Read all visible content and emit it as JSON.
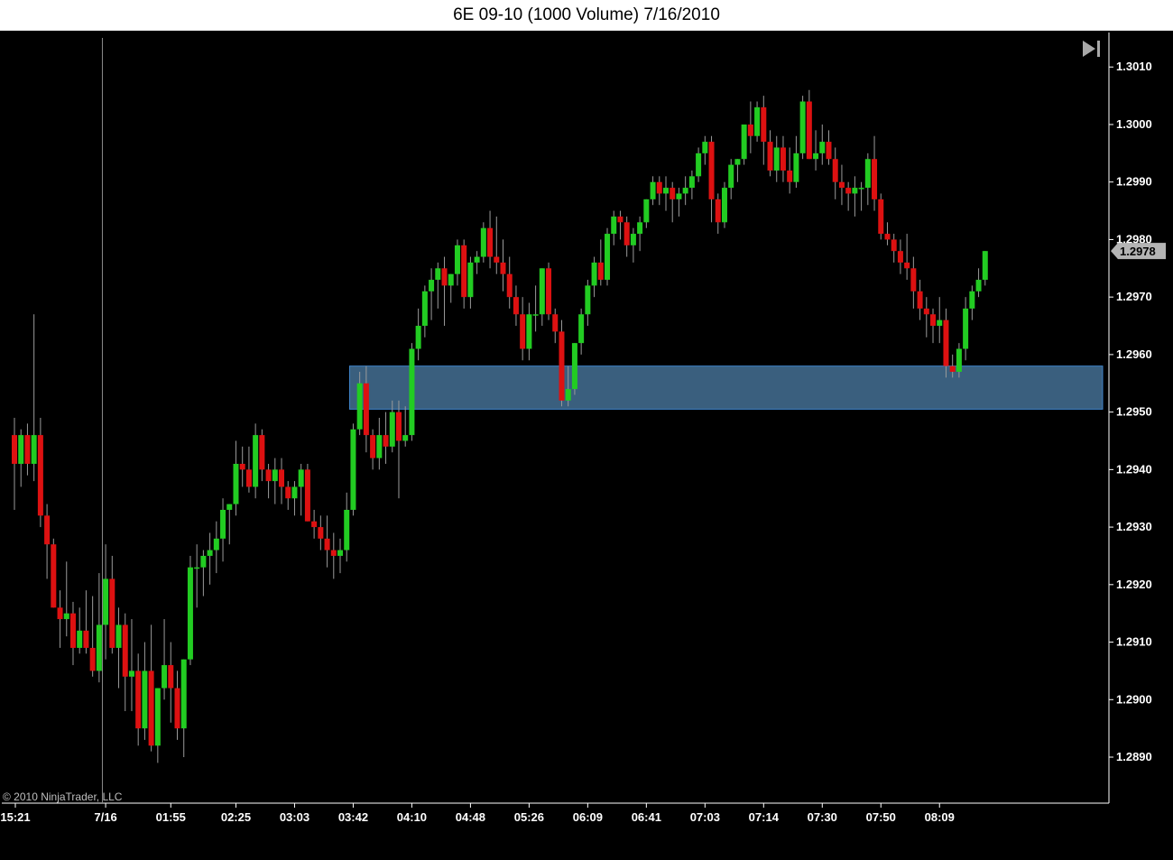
{
  "window": {
    "title": "6E 09-10 (1000 Volume)  7/16/2010"
  },
  "copyright": "© 2010 NinjaTrader, LLC",
  "colors": {
    "background": "#000000",
    "up": "#22cc22",
    "down": "#dd1111",
    "wick": "#9a9a9a",
    "axis": "#ffffff",
    "zone_fill": "#3a5f7e",
    "zone_stroke": "#3e82c8",
    "price_marker": "#b4b4b4"
  },
  "icons": {
    "goto_end": "skip-to-end-icon"
  },
  "chart_data": {
    "type": "candlestick",
    "symbol": "6E 09-10",
    "ylim": [
      1.2882,
      1.3016
    ],
    "y_ticks": [
      "1.2890",
      "1.2900",
      "1.2910",
      "1.2920",
      "1.2930",
      "1.2940",
      "1.2950",
      "1.2960",
      "1.2970",
      "1.2980",
      "1.2990",
      "1.3000",
      "1.3010"
    ],
    "x_ticks": [
      {
        "label": "15:21",
        "bar": 0
      },
      {
        "label": "7/16",
        "bar": 14
      },
      {
        "label": "01:55",
        "bar": 24
      },
      {
        "label": "02:25",
        "bar": 34
      },
      {
        "label": "03:03",
        "bar": 43
      },
      {
        "label": "03:42",
        "bar": 52
      },
      {
        "label": "04:10",
        "bar": 61
      },
      {
        "label": "04:48",
        "bar": 70
      },
      {
        "label": "05:26",
        "bar": 79
      },
      {
        "label": "06:09",
        "bar": 88
      },
      {
        "label": "06:41",
        "bar": 97
      },
      {
        "label": "07:03",
        "bar": 106
      },
      {
        "label": "07:14",
        "bar": 115
      },
      {
        "label": "07:30",
        "bar": 124
      },
      {
        "label": "07:50",
        "bar": 133
      },
      {
        "label": "08:09",
        "bar": 142
      }
    ],
    "session_break_bar": 13,
    "last_price": "1.2978",
    "zone": {
      "low": 1.29505,
      "high": 1.2958,
      "start_bar": 52
    },
    "candles": [
      [
        1.2946,
        1.2949,
        1.2933,
        1.2941
      ],
      [
        1.2941,
        1.2947,
        1.2937,
        1.2946
      ],
      [
        1.2946,
        1.2948,
        1.2939,
        1.2941
      ],
      [
        1.2941,
        1.2967,
        1.2938,
        1.2946
      ],
      [
        1.2946,
        1.2949,
        1.293,
        1.2932
      ],
      [
        1.2932,
        1.2934,
        1.2921,
        1.2927
      ],
      [
        1.2927,
        1.2928,
        1.2916,
        1.2916
      ],
      [
        1.2916,
        1.2919,
        1.2909,
        1.2914
      ],
      [
        1.2914,
        1.2924,
        1.2911,
        1.2915
      ],
      [
        1.2915,
        1.2917,
        1.2906,
        1.2909
      ],
      [
        1.2909,
        1.2916,
        1.2908,
        1.2912
      ],
      [
        1.2912,
        1.2919,
        1.2908,
        1.2909
      ],
      [
        1.2909,
        1.2918,
        1.2904,
        1.2905
      ],
      [
        1.2905,
        1.2922,
        1.2903,
        1.2913
      ],
      [
        1.2913,
        1.2927,
        1.2907,
        1.2921
      ],
      [
        1.2921,
        1.2925,
        1.2908,
        1.2909
      ],
      [
        1.2909,
        1.2916,
        1.2902,
        1.2913
      ],
      [
        1.2913,
        1.2915,
        1.2898,
        1.2904
      ],
      [
        1.2904,
        1.2914,
        1.2898,
        1.2905
      ],
      [
        1.2905,
        1.2908,
        1.2892,
        1.2895
      ],
      [
        1.2895,
        1.291,
        1.2893,
        1.2905
      ],
      [
        1.2905,
        1.2913,
        1.2891,
        1.2892
      ],
      [
        1.2892,
        1.2902,
        1.2889,
        1.2902
      ],
      [
        1.2902,
        1.2914,
        1.29,
        1.2906
      ],
      [
        1.2906,
        1.291,
        1.2896,
        1.2902
      ],
      [
        1.2902,
        1.2905,
        1.2893,
        1.2895
      ],
      [
        1.2895,
        1.2907,
        1.289,
        1.2907
      ],
      [
        1.2907,
        1.2925,
        1.2906,
        1.2923
      ],
      [
        1.2923,
        1.2927,
        1.2916,
        1.2923
      ],
      [
        1.2923,
        1.2926,
        1.2918,
        1.2925
      ],
      [
        1.2925,
        1.2929,
        1.292,
        1.2926
      ],
      [
        1.2926,
        1.2931,
        1.2922,
        1.2928
      ],
      [
        1.2928,
        1.2935,
        1.2924,
        1.2933
      ],
      [
        1.2933,
        1.2934,
        1.2927,
        1.2934
      ],
      [
        1.2934,
        1.2945,
        1.2932,
        1.2941
      ],
      [
        1.2941,
        1.2944,
        1.2937,
        1.294
      ],
      [
        1.294,
        1.2944,
        1.2936,
        1.2937
      ],
      [
        1.2937,
        1.2948,
        1.2935,
        1.2946
      ],
      [
        1.2946,
        1.2947,
        1.2938,
        1.294
      ],
      [
        1.294,
        1.2941,
        1.2935,
        1.2938
      ],
      [
        1.2938,
        1.2942,
        1.2934,
        1.294
      ],
      [
        1.294,
        1.2942,
        1.2934,
        1.2937
      ],
      [
        1.2937,
        1.2938,
        1.2933,
        1.2935
      ],
      [
        1.2935,
        1.2938,
        1.2932,
        1.2937
      ],
      [
        1.2937,
        1.2941,
        1.2932,
        1.294
      ],
      [
        1.294,
        1.2941,
        1.2931,
        1.2931
      ],
      [
        1.2931,
        1.2933,
        1.2928,
        1.293
      ],
      [
        1.293,
        1.2932,
        1.2926,
        1.2928
      ],
      [
        1.2928,
        1.2932,
        1.2923,
        1.2926
      ],
      [
        1.2926,
        1.2929,
        1.2921,
        1.2925
      ],
      [
        1.2925,
        1.2928,
        1.2922,
        1.2926
      ],
      [
        1.2926,
        1.2936,
        1.2924,
        1.2933
      ],
      [
        1.2933,
        1.2948,
        1.2932,
        1.2947
      ],
      [
        1.2947,
        1.2957,
        1.2946,
        1.2955
      ],
      [
        1.2955,
        1.2958,
        1.2943,
        1.2946
      ],
      [
        1.2946,
        1.2947,
        1.294,
        1.2942
      ],
      [
        1.2942,
        1.2949,
        1.294,
        1.2946
      ],
      [
        1.2946,
        1.295,
        1.2941,
        1.2944
      ],
      [
        1.2944,
        1.2952,
        1.2943,
        1.295
      ],
      [
        1.295,
        1.2952,
        1.2935,
        1.2945
      ],
      [
        1.2945,
        1.2951,
        1.2944,
        1.2946
      ],
      [
        1.2946,
        1.2962,
        1.2945,
        1.2961
      ],
      [
        1.2961,
        1.2968,
        1.2959,
        1.2965
      ],
      [
        1.2965,
        1.2972,
        1.2963,
        1.2971
      ],
      [
        1.2971,
        1.2975,
        1.2966,
        1.2973
      ],
      [
        1.2973,
        1.2976,
        1.2968,
        1.2975
      ],
      [
        1.2975,
        1.2977,
        1.2965,
        1.2972
      ],
      [
        1.2972,
        1.2974,
        1.2969,
        1.2974
      ],
      [
        1.2974,
        1.298,
        1.2972,
        1.2979
      ],
      [
        1.2979,
        1.298,
        1.2968,
        1.297
      ],
      [
        1.297,
        1.2977,
        1.2968,
        1.2976
      ],
      [
        1.2976,
        1.2978,
        1.2974,
        1.2977
      ],
      [
        1.2977,
        1.2983,
        1.2976,
        1.2982
      ],
      [
        1.2982,
        1.2985,
        1.2975,
        1.2977
      ],
      [
        1.2977,
        1.2984,
        1.2974,
        1.2976
      ],
      [
        1.2976,
        1.298,
        1.2971,
        1.2974
      ],
      [
        1.2974,
        1.2977,
        1.2968,
        1.297
      ],
      [
        1.297,
        1.2972,
        1.2965,
        1.2967
      ],
      [
        1.2967,
        1.297,
        1.2959,
        1.2961
      ],
      [
        1.2961,
        1.2969,
        1.2959,
        1.2967
      ],
      [
        1.2967,
        1.2972,
        1.2964,
        1.2967
      ],
      [
        1.2967,
        1.2975,
        1.2965,
        1.2975
      ],
      [
        1.2975,
        1.2976,
        1.2966,
        1.2967
      ],
      [
        1.2967,
        1.2968,
        1.2962,
        1.2964
      ],
      [
        1.2964,
        1.2966,
        1.2951,
        1.2952
      ],
      [
        1.2952,
        1.2958,
        1.2951,
        1.2954
      ],
      [
        1.2954,
        1.2962,
        1.2953,
        1.2962
      ],
      [
        1.2962,
        1.2968,
        1.296,
        1.2967
      ],
      [
        1.2967,
        1.2973,
        1.2965,
        1.2972
      ],
      [
        1.2972,
        1.2977,
        1.297,
        1.2976
      ],
      [
        1.2976,
        1.298,
        1.2972,
        1.2973
      ],
      [
        1.2973,
        1.2982,
        1.2972,
        1.2981
      ],
      [
        1.2981,
        1.2985,
        1.2979,
        1.2984
      ],
      [
        1.2984,
        1.2985,
        1.298,
        1.2983
      ],
      [
        1.2983,
        1.2984,
        1.2977,
        1.2979
      ],
      [
        1.2979,
        1.2982,
        1.2976,
        1.2981
      ],
      [
        1.2981,
        1.2984,
        1.2978,
        1.2983
      ],
      [
        1.2983,
        1.2987,
        1.2982,
        1.2987
      ],
      [
        1.2987,
        1.2991,
        1.2986,
        1.299
      ],
      [
        1.299,
        1.2991,
        1.2986,
        1.2988
      ],
      [
        1.2988,
        1.2991,
        1.2985,
        1.2989
      ],
      [
        1.2989,
        1.299,
        1.2983,
        1.2987
      ],
      [
        1.2987,
        1.2989,
        1.2984,
        1.2988
      ],
      [
        1.2988,
        1.2991,
        1.2986,
        1.2989
      ],
      [
        1.2989,
        1.2992,
        1.2987,
        1.2991
      ],
      [
        1.2991,
        1.2996,
        1.299,
        1.2995
      ],
      [
        1.2995,
        1.2998,
        1.2993,
        1.2997
      ],
      [
        1.2997,
        1.2998,
        1.2983,
        1.2987
      ],
      [
        1.2987,
        1.2988,
        1.2981,
        1.2983
      ],
      [
        1.2983,
        1.299,
        1.2982,
        1.2989
      ],
      [
        1.2989,
        1.2994,
        1.2987,
        1.2993
      ],
      [
        1.2993,
        1.2994,
        1.299,
        1.2994
      ],
      [
        1.2994,
        1.3,
        1.2993,
        1.3
      ],
      [
        1.3,
        1.3004,
        1.2995,
        1.2998
      ],
      [
        1.2998,
        1.3004,
        1.2997,
        1.3003
      ],
      [
        1.3003,
        1.3005,
        1.2993,
        1.2997
      ],
      [
        1.2997,
        1.2999,
        1.2991,
        1.2992
      ],
      [
        1.2992,
        1.2998,
        1.299,
        1.2996
      ],
      [
        1.2996,
        1.2998,
        1.299,
        1.2992
      ],
      [
        1.2992,
        1.2996,
        1.2988,
        1.299
      ],
      [
        1.299,
        1.2998,
        1.2989,
        1.2995
      ],
      [
        1.2995,
        1.3005,
        1.2994,
        1.3004
      ],
      [
        1.3004,
        1.3006,
        1.2994,
        1.2994
      ],
      [
        1.2994,
        1.2999,
        1.2992,
        1.2995
      ],
      [
        1.2995,
        1.3,
        1.2993,
        1.2997
      ],
      [
        1.2997,
        1.2999,
        1.2993,
        1.2994
      ],
      [
        1.2994,
        1.2996,
        1.2987,
        1.299
      ],
      [
        1.299,
        1.2993,
        1.2986,
        1.2989
      ],
      [
        1.2989,
        1.299,
        1.2985,
        1.2988
      ],
      [
        1.2988,
        1.2991,
        1.2984,
        1.2989
      ],
      [
        1.2989,
        1.299,
        1.2985,
        1.2989
      ],
      [
        1.2989,
        1.2995,
        1.2986,
        1.2994
      ],
      [
        1.2994,
        1.2998,
        1.2985,
        1.2987
      ],
      [
        1.2987,
        1.2988,
        1.298,
        1.2981
      ],
      [
        1.2981,
        1.2983,
        1.2979,
        1.298
      ],
      [
        1.298,
        1.2981,
        1.2976,
        1.2978
      ],
      [
        1.2978,
        1.298,
        1.2974,
        1.2976
      ],
      [
        1.2976,
        1.2981,
        1.2973,
        1.2975
      ],
      [
        1.2975,
        1.2977,
        1.2968,
        1.2971
      ],
      [
        1.2971,
        1.2973,
        1.2966,
        1.2968
      ],
      [
        1.2968,
        1.297,
        1.2963,
        1.2967
      ],
      [
        1.2967,
        1.2968,
        1.2962,
        1.2965
      ],
      [
        1.2965,
        1.297,
        1.2962,
        1.2966
      ],
      [
        1.2966,
        1.2968,
        1.2956,
        1.2958
      ],
      [
        1.2958,
        1.296,
        1.2956,
        1.2957
      ],
      [
        1.2957,
        1.2962,
        1.2956,
        1.2961
      ],
      [
        1.2961,
        1.297,
        1.2959,
        1.2968
      ],
      [
        1.2968,
        1.2972,
        1.2966,
        1.2971
      ],
      [
        1.2971,
        1.2975,
        1.297,
        1.2973
      ],
      [
        1.2973,
        1.2978,
        1.2972,
        1.2978
      ]
    ]
  }
}
